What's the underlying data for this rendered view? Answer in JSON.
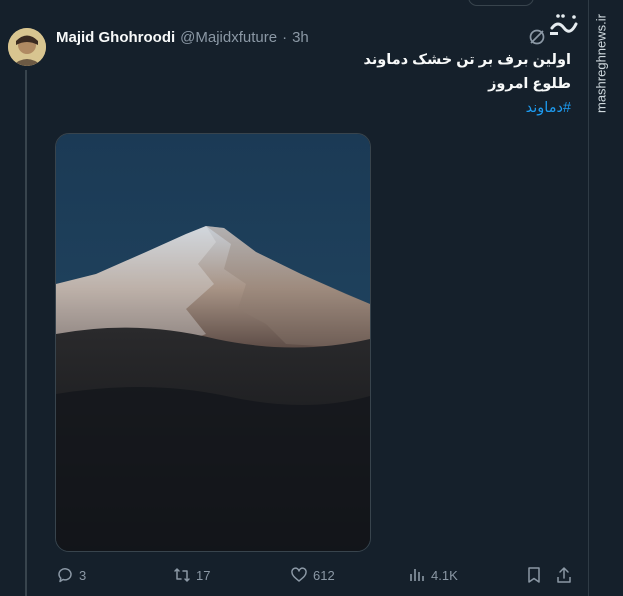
{
  "tweet": {
    "author_name": "Majid Ghohroodi",
    "handle": "@Majidxfuture",
    "separator": "·",
    "time": "3h",
    "text_line1": "اولین برف بر تن خشک دماوند",
    "text_line2": "طلوع امروز",
    "hashtag": "#دماوند"
  },
  "actions": {
    "replies": "3",
    "retweets": "17",
    "likes": "612",
    "views": "4.1K"
  },
  "watermark": {
    "logo_text": "مشرق",
    "site": "mashreghnews.ir"
  },
  "colors": {
    "background": "#15202b",
    "accent": "#1d9bf0",
    "muted": "#8b98a5",
    "border": "#38444d"
  }
}
